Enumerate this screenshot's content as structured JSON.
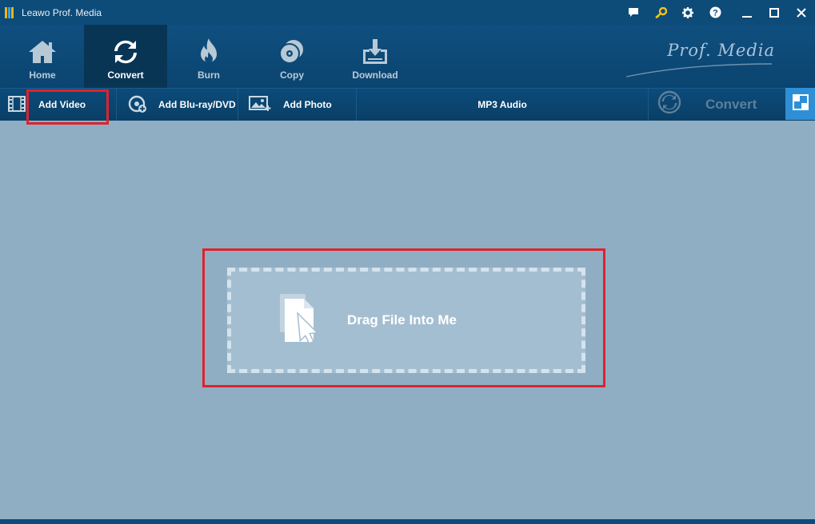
{
  "window": {
    "title": "Leawo Prof. Media",
    "controls": [
      "chat-icon",
      "key-icon",
      "gear-icon",
      "help-icon",
      "minimize-icon",
      "maximize-icon",
      "close-icon"
    ]
  },
  "nav": {
    "items": [
      {
        "label": "Home",
        "icon": "home-icon"
      },
      {
        "label": "Convert",
        "icon": "convert-icon",
        "active": true
      },
      {
        "label": "Burn",
        "icon": "burn-icon"
      },
      {
        "label": "Copy",
        "icon": "copy-icon"
      },
      {
        "label": "Download",
        "icon": "download-icon"
      }
    ],
    "brand": "Prof. Media"
  },
  "toolbar": {
    "add_video": "Add Video",
    "add_bluray": "Add Blu-ray/DVD",
    "add_photo": "Add Photo",
    "profile": "MP3 Audio",
    "convert": "Convert"
  },
  "dropzone": {
    "label": "Drag File Into Me"
  },
  "colors": {
    "titlebar": "#0d4b79",
    "background": "#8faec4",
    "highlight": "#e0222c",
    "accent": "#2f8fd6"
  }
}
